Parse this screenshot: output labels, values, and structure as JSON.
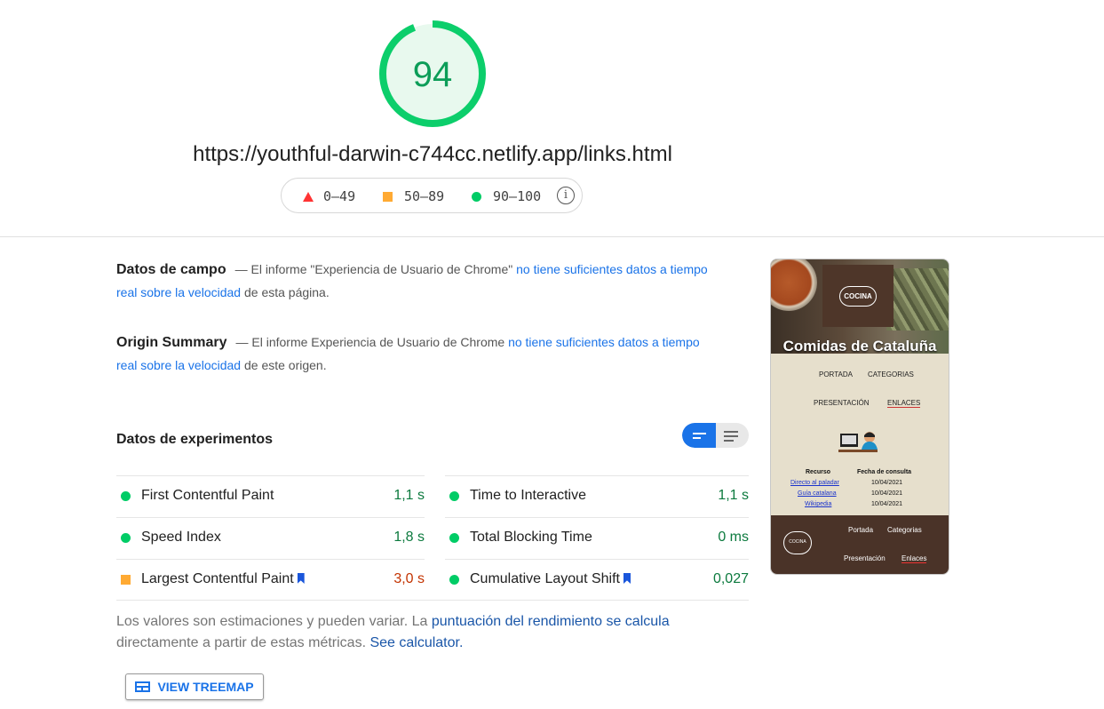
{
  "header": {
    "score": "94",
    "url": "https://youthful-darwin-c744cc.netlify.app/links.html",
    "legend": {
      "fail": "0–49",
      "average": "50–89",
      "pass": "90–100"
    },
    "colors": {
      "pass": "#0cce6b",
      "average": "#ffa400",
      "fail": "#ff4e42"
    }
  },
  "field_data": {
    "title": "Datos de campo",
    "text_before": "— El informe \"Experiencia de Usuario de Chrome\" ",
    "link": "no tiene suficientes datos a tiempo real sobre la velocidad",
    "text_after": " de esta página."
  },
  "origin_summary": {
    "title": "Origin Summary",
    "text_before": "— El informe Experiencia de Usuario de Chrome ",
    "link": "no tiene suficientes datos a tiempo real sobre la velocidad",
    "text_after": " de este origen."
  },
  "lab_data": {
    "title": "Datos de experimentos",
    "metrics": [
      {
        "name": "First Contentful Paint",
        "value": "1,1 s",
        "status": "pass",
        "flag": false
      },
      {
        "name": "Time to Interactive",
        "value": "1,1 s",
        "status": "pass",
        "flag": false
      },
      {
        "name": "Speed Index",
        "value": "1,8 s",
        "status": "pass",
        "flag": false
      },
      {
        "name": "Total Blocking Time",
        "value": "0 ms",
        "status": "pass",
        "flag": false
      },
      {
        "name": "Largest Contentful Paint",
        "value": "3,0 s",
        "status": "average",
        "flag": true
      },
      {
        "name": "Cumulative Layout Shift",
        "value": "0,027",
        "status": "pass",
        "flag": true
      }
    ]
  },
  "footnote": {
    "text1": "Los valores son estimaciones y pueden variar. La ",
    "link1": "puntuación del rendimiento se calcula",
    "text2": " directamente a partir de estas métricas. ",
    "link2": "See calculator."
  },
  "treemap_button": "VIEW TREEMAP",
  "thumbnail": {
    "logo": "COCINA",
    "title": "Comidas de Cataluña",
    "nav": [
      "PORTADA",
      "CATEGORIAS",
      "PRESENTACIÓN",
      "ENLACES"
    ],
    "table_headers": [
      "Recurso",
      "Fecha de consulta"
    ],
    "rows": [
      {
        "link": "Directo al paladar",
        "date": "10/04/2021"
      },
      {
        "link": "Guía catalana",
        "date": "10/04/2021"
      },
      {
        "link": "Wikipedia",
        "date": "10/04/2021"
      }
    ],
    "footer_nav": [
      "Portada",
      "Categorias",
      "Presentación",
      "Enlaces"
    ]
  }
}
